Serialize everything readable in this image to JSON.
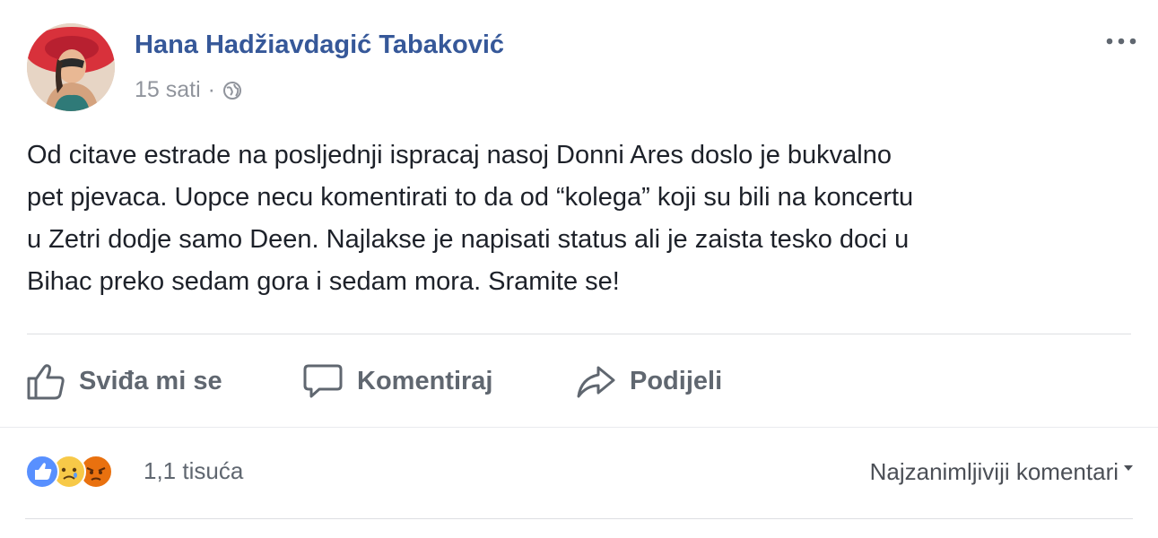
{
  "post": {
    "author": "Hana Hadžiavdagić Tabaković",
    "time": "15 sati",
    "separator": "·",
    "privacy_icon": "globe-icon",
    "text_lines": [
      "Od citave estrade na posljednji ispracaj nasoj Donni Ares doslo je bukvalno",
      "pet pjevaca. Uopce necu komentirati to da od “kolega” koji su bili na koncertu",
      "u Zetri dodje samo Deen. Najlakse je napisati status ali je zaista tesko doci u",
      "Bihac preko sedam gora i sedam mora. Sramite se!"
    ]
  },
  "actions": {
    "like": {
      "label": "Sviđa mi se",
      "icon": "thumbs-up-icon"
    },
    "comment": {
      "label": "Komentiraj",
      "icon": "comment-icon"
    },
    "share": {
      "label": "Podijeli",
      "icon": "share-icon"
    }
  },
  "reactions": {
    "icons": [
      "like-reaction-icon",
      "sad-reaction-icon",
      "angry-reaction-icon"
    ],
    "count": "1,1 tisuća"
  },
  "comments": {
    "sort_label": "Najzanimljiviji komentari"
  },
  "colors": {
    "name": "#365899",
    "like_blue": "#5890ff",
    "sad_yellow": "#f7c948",
    "angry_orange": "#e9710f"
  }
}
